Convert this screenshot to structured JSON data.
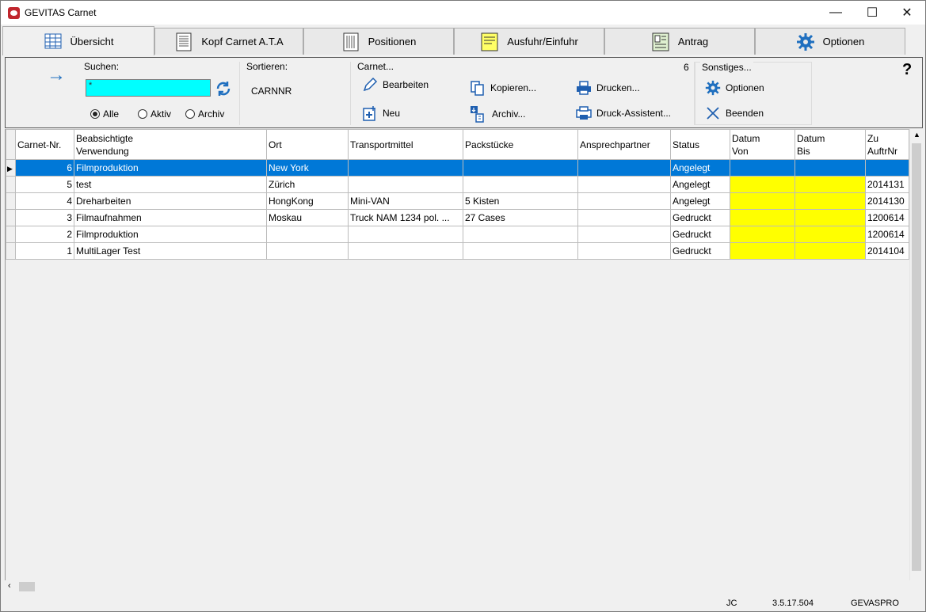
{
  "window": {
    "title": "GEVITAS Carnet",
    "minimize": "—",
    "maximize": "☐",
    "close": "✕"
  },
  "tabs": [
    {
      "label": "Übersicht",
      "icon": "table-icon"
    },
    {
      "label": "Kopf Carnet A.T.A",
      "icon": "document-header-icon"
    },
    {
      "label": "Positionen",
      "icon": "document-list-icon"
    },
    {
      "label": "Ausfuhr/Einfuhr",
      "icon": "yellow-note-icon"
    },
    {
      "label": "Antrag",
      "icon": "form-icon"
    },
    {
      "label": "Optionen",
      "icon": "gear-icon"
    }
  ],
  "toolbar": {
    "go_arrow": "→",
    "search": {
      "label": "Suchen:",
      "value": "*",
      "refresh_icon": "refresh-icon"
    },
    "filters": [
      {
        "label": "Alle",
        "checked": true
      },
      {
        "label": "Aktiv",
        "checked": false
      },
      {
        "label": "Archiv",
        "checked": false
      }
    ],
    "sort": {
      "label": "Sortieren:",
      "value": "CARNNR"
    },
    "carnet": {
      "label": "Carnet...",
      "count": "6",
      "actions": [
        {
          "label": "Bearbeiten",
          "icon": "pencil-icon"
        },
        {
          "label": "Kopieren...",
          "icon": "copy-icon"
        },
        {
          "label": "Drucken...",
          "icon": "printer-icon"
        },
        {
          "label": "Neu",
          "icon": "new-icon"
        },
        {
          "label": "Archiv...",
          "icon": "archive-icon"
        },
        {
          "label": "Druck-Assistent...",
          "icon": "print-wizard-icon"
        }
      ]
    },
    "misc": {
      "label": "Sonstiges...",
      "actions": [
        {
          "label": "Optionen",
          "icon": "gear-icon"
        },
        {
          "label": "Beenden",
          "icon": "close-icon"
        }
      ]
    },
    "help": "?"
  },
  "table": {
    "columns": [
      "Carnet-Nr.",
      "Beabsichtigte\nVerwendung",
      "Ort",
      "Transportmittel",
      "Packstücke",
      "Ansprechpartner",
      "Status",
      "Datum\nVon",
      "Datum\nBis",
      "Zu\nAuftrNr"
    ],
    "rows": [
      [
        "6",
        "Filmproduktion",
        "New York",
        "",
        "",
        "",
        "Angelegt",
        "",
        "",
        ""
      ],
      [
        "5",
        "test",
        "Zürich",
        "",
        "",
        "",
        "Angelegt",
        "",
        "",
        "2014131"
      ],
      [
        "4",
        "Dreharbeiten",
        "HongKong",
        "Mini-VAN",
        "5 Kisten",
        "",
        "Angelegt",
        "",
        "",
        "2014130"
      ],
      [
        "3",
        "Filmaufnahmen",
        "Moskau",
        "Truck NAM 1234 pol. ...",
        "27 Cases",
        "",
        "Gedruckt",
        "",
        "",
        "1200614"
      ],
      [
        "2",
        "Filmproduktion",
        "",
        "",
        "",
        "",
        "Gedruckt",
        "",
        "",
        "1200614"
      ],
      [
        "1",
        "MultiLager Test",
        "",
        "",
        "",
        "",
        "Gedruckt",
        "",
        "",
        "2014104"
      ]
    ],
    "selected_row": 0
  },
  "status": {
    "user": "JC",
    "version": "3.5.17.504",
    "db": "GEVASPRO"
  },
  "colors": {
    "selection": "#0078d7",
    "search_bg": "#00ffff",
    "date_highlight": "#ffff00"
  }
}
